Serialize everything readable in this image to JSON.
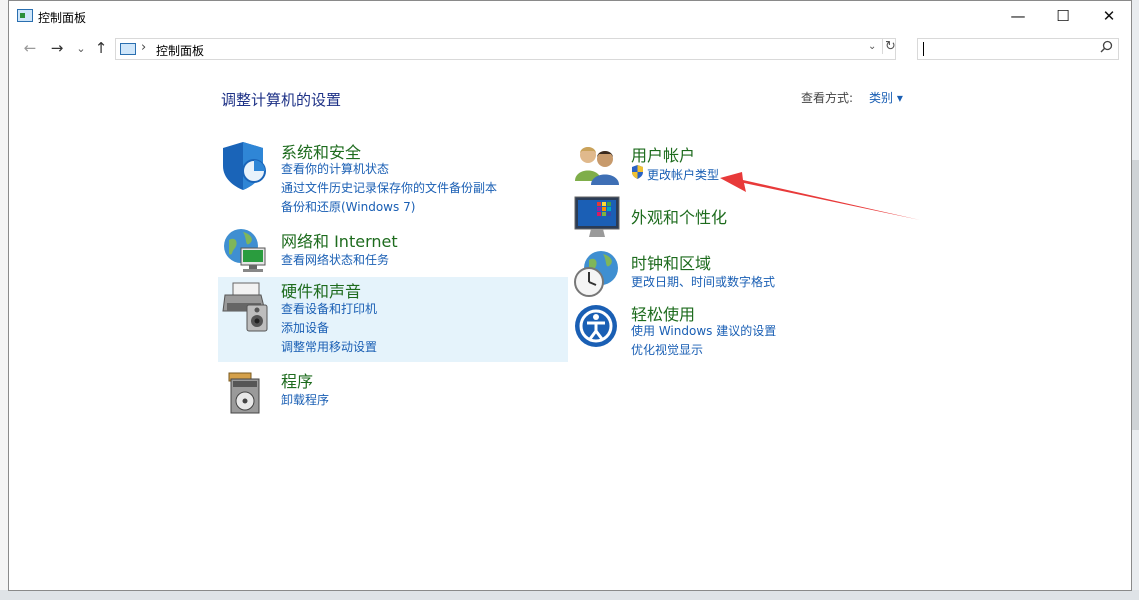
{
  "window": {
    "title": "控制面板",
    "minimize": "—",
    "maximize": "☐",
    "close": "✕"
  },
  "nav": {
    "back": "←",
    "forward": "→",
    "recent": "⌄",
    "up": "↑"
  },
  "address": {
    "separator": "›",
    "crumb": "控制面板",
    "dropdown": "⌄",
    "refresh": "↻"
  },
  "search": {
    "value": "",
    "placeholder": "",
    "icon": "search-icon"
  },
  "main": {
    "heading": "调整计算机的设置",
    "view_by_label": "查看方式:",
    "view_by_value": "类别",
    "view_by_caret": "▾"
  },
  "categories": {
    "system": {
      "title": "系统和安全",
      "links": [
        "查看你的计算机状态",
        "通过文件历史记录保存你的文件备份副本",
        "备份和还原(Windows 7)"
      ]
    },
    "network": {
      "title": "网络和 Internet",
      "links": [
        "查看网络状态和任务"
      ]
    },
    "hardware": {
      "title": "硬件和声音",
      "links": [
        "查看设备和打印机",
        "添加设备",
        "调整常用移动设置"
      ]
    },
    "programs": {
      "title": "程序",
      "links": [
        "卸载程序"
      ]
    },
    "user": {
      "title": "用户帐户",
      "links": [
        "更改帐户类型"
      ]
    },
    "appearance": {
      "title": "外观和个性化",
      "links": []
    },
    "clock": {
      "title": "时钟和区域",
      "links": [
        "更改日期、时间或数字格式"
      ]
    },
    "ease": {
      "title": "轻松使用",
      "links": [
        "使用 Windows 建议的设置",
        "优化视觉显示"
      ]
    }
  },
  "colors": {
    "link": "#1a5fb4",
    "category": "#1d6b1d",
    "heading": "#1e3287",
    "highlight": "#e5f3fb",
    "annotation_arrow": "#e83a3a"
  }
}
